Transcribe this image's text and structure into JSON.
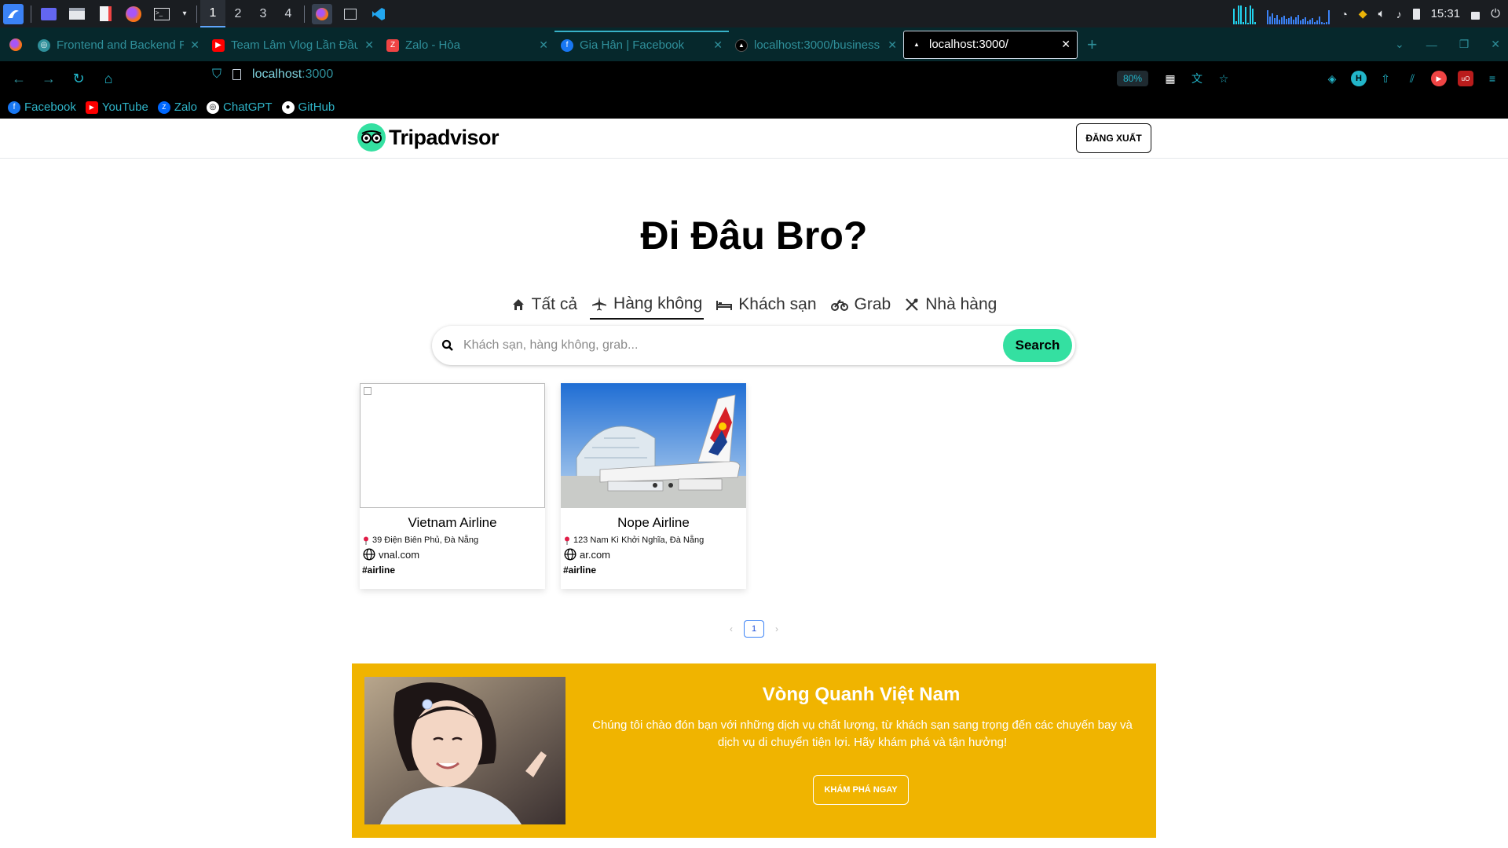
{
  "os": {
    "workspaces": [
      "1",
      "2",
      "3",
      "4"
    ],
    "active_workspace": "1",
    "clock": "15:31"
  },
  "browser": {
    "tabs": [
      {
        "title": "Frontend and Backend Repo",
        "favicon": "chatgpt-icon"
      },
      {
        "title": "Team Lâm Vlog Lần Đầu",
        "favicon": "youtube-icon"
      },
      {
        "title": "Zalo - Hòa",
        "favicon": "zalo-icon"
      },
      {
        "title": "Gia Hân | Facebook",
        "favicon": "facebook-icon"
      },
      {
        "title": "localhost:3000/business",
        "favicon": "triangle-icon"
      },
      {
        "title": "localhost:3000/",
        "favicon": "triangle-icon"
      }
    ],
    "active_tab_index": 5,
    "url_host": "localhost",
    "url_port": ":3000",
    "zoom": "80%",
    "bookmarks": [
      {
        "label": "Facebook",
        "icon": "facebook-icon",
        "color": "#1877f2"
      },
      {
        "label": "YouTube",
        "icon": "youtube-icon",
        "color": "#ff0000"
      },
      {
        "label": "Zalo",
        "icon": "zalo-icon",
        "color": "#0068ff"
      },
      {
        "label": "ChatGPT",
        "icon": "chatgpt-icon",
        "color": "#ffffff"
      },
      {
        "label": "GitHub",
        "icon": "github-icon",
        "color": "#ffffff"
      }
    ]
  },
  "site": {
    "brand": "Tripadvisor",
    "brand_color": "#34e0a1",
    "logout_label": "ĐĂNG XUẤT",
    "hero_title": "Đi Đâu Bro?",
    "categories": [
      {
        "label": "Tất cả",
        "icon": "home-icon"
      },
      {
        "label": "Hàng không",
        "icon": "plane-icon"
      },
      {
        "label": "Khách sạn",
        "icon": "bed-icon"
      },
      {
        "label": "Grab",
        "icon": "motorbike-icon"
      },
      {
        "label": "Nhà hàng",
        "icon": "utensils-icon"
      }
    ],
    "active_category": "Hàng không",
    "search": {
      "placeholder": "Khách sạn, hàng không, grab...",
      "value": "",
      "button_label": "Search"
    },
    "cards": [
      {
        "name": "Vietnam Airline",
        "address": "39 Điện Biên Phủ, Đà Nẵng",
        "website": "vnal.com",
        "tag": "#airline",
        "image": "broken"
      },
      {
        "name": "Nope Airline",
        "address": "123 Nam Kì Khởi Nghĩa, Đà Nẵng",
        "website": "ar.com",
        "tag": "#airline",
        "image": "airplane-photo"
      }
    ],
    "pagination": {
      "current_page": "1"
    },
    "promo": {
      "title": "Vòng Quanh Việt Nam",
      "text": "Chúng tôi chào đón bạn với những dịch vụ chất lượng, từ khách sạn sang trọng đến các chuyến bay và dịch vụ di chuyển tiện lợi. Hãy khám phá và tận hưởng!",
      "button_label": "KHÁM PHÁ NGAY",
      "background": "#f0b400"
    }
  }
}
